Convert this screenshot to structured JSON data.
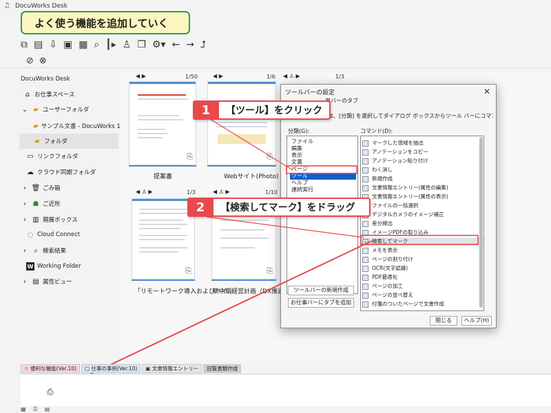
{
  "window": {
    "title": "DocuWorks Desk",
    "logo": "DocuWorks-logo-icon"
  },
  "caption": "よく使う機能を追加していく",
  "toolbar1": [
    "view-icon",
    "page-icon",
    "download-icon",
    "window-icon",
    "grid-icon",
    "search-icon",
    "split-icon",
    "stamp-icon",
    "copy-icon",
    "settings-icon",
    "back-icon",
    "forward-icon",
    "up-icon"
  ],
  "toolbar2": [
    "tag-icon",
    "link-icon"
  ],
  "sidebar": {
    "items": [
      {
        "label": "DocuWorks Desk",
        "icon": "none"
      },
      {
        "label": "お仕事スペース",
        "icon": "workspace-icon"
      },
      {
        "label": "ユーザーフォルダ",
        "icon": "folder-icon"
      },
      {
        "label": "サンプル文書 - DocuWorks 10",
        "icon": "folder-icon"
      },
      {
        "label": "フォルダ",
        "icon": "folder-icon"
      },
      {
        "label": "リンクフォルダ",
        "icon": "link-folder-icon"
      },
      {
        "label": "クラウド同期フォルダ",
        "icon": "cloud-icon"
      },
      {
        "label": "ごみ箱",
        "icon": "trash-icon"
      },
      {
        "label": "ご近所",
        "icon": "neighbor-icon"
      },
      {
        "label": "親展ボックス",
        "icon": "box-icon"
      },
      {
        "label": "Cloud Connect",
        "icon": "cloud-connect-icon"
      },
      {
        "label": "検索結果",
        "icon": "search-icon"
      },
      {
        "label": "Working Folder",
        "icon": "w-icon"
      },
      {
        "label": "属性ビュー",
        "icon": "view-icon"
      }
    ]
  },
  "documents": [
    {
      "name": "提案書",
      "pages": "1/50"
    },
    {
      "name": "Webサイト(Photo)",
      "pages": "1/6"
    },
    {
      "name": "",
      "pages": "1/3"
    },
    {
      "name": "「リモートワーク導入およびハイ…",
      "pages": "1/3"
    },
    {
      "name": "新中期経営計画（DX推進・…",
      "pages": "1/10"
    }
  ],
  "dialog": {
    "title": "ツールバーの設定",
    "close": "✕",
    "desc_tail": "事バーのタブ",
    "desc": "…加するには、[分類] を選択してダイアログ ボックスからツール バーにコマンドをドラッグして",
    "category_label": "分類(G):",
    "command_label": "コマンド(D):",
    "categories": [
      "ファイル",
      "編集",
      "表示",
      "文書",
      "ページ",
      "ツール",
      "ヘルプ",
      "連続実行"
    ],
    "selected_category": 5,
    "commands": [
      "マークした領域を抽出",
      "アノテーションをコピー",
      "アノテーション貼り付け",
      "わく消し",
      "新規作成",
      "文書情報エントリー(属性の編集)",
      "文書情報エントリー(属性の表示)",
      "ファイルの一括選択",
      "デジタルカメラのイメージ補正",
      "差分検出",
      "イメージPDFの取り込み",
      "検索してマーク",
      "メモを表示",
      "ページの割り付け",
      "OCR(文字認識)",
      "PDF最適化",
      "ページの加工",
      "ページの並べ替え",
      "付箋のついたページで文書作成"
    ],
    "highlighted_command": 11,
    "btn_new_toolbar": "ツールバーの新規作成",
    "btn_add_tab": "お仕事バーにタブを追加",
    "btn_close": "閉じる",
    "btn_help": "ヘルプ(H)"
  },
  "callouts": [
    {
      "num": "1",
      "text": "【ツール】をクリック"
    },
    {
      "num": "2",
      "text": "【検索してマーク】をドラッグ"
    }
  ],
  "tabs": [
    {
      "label": "便利な機能(Ver.10)",
      "color": "#f6d6dc"
    },
    {
      "label": "仕事の事例(Ver.10)",
      "color": "#d8e4f4"
    },
    {
      "label": "文書情報エントリー",
      "color": "#e6e6e6"
    },
    {
      "label": "回覧書類作成",
      "color": "#cfcfcf"
    }
  ],
  "accent_red": "#e8494c"
}
